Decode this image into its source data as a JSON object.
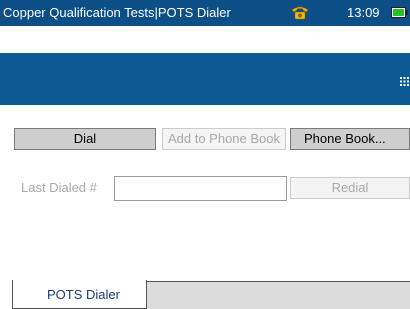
{
  "titlebar": {
    "title": "Copper Qualification Tests|POTS Dialer",
    "time": "13:09",
    "phone_icon": "phone-icon",
    "battery_icon": "battery-icon"
  },
  "toolbar": {
    "menu_icon": "grid-menu-icon"
  },
  "actions": {
    "dial_label": "Dial",
    "add_phonebook_label": "Add to Phone Book",
    "phonebook_label": "Phone Book..."
  },
  "last_dialed": {
    "label": "Last Dialed #",
    "value": "",
    "redial_label": "Redial"
  },
  "tabs": [
    {
      "label": "POTS Dialer"
    }
  ],
  "colors": {
    "titlebar": "#0b4f86",
    "banner": "#0b5a94",
    "phone_icon": "#f2b90f",
    "battery_icon": "#22c322"
  }
}
